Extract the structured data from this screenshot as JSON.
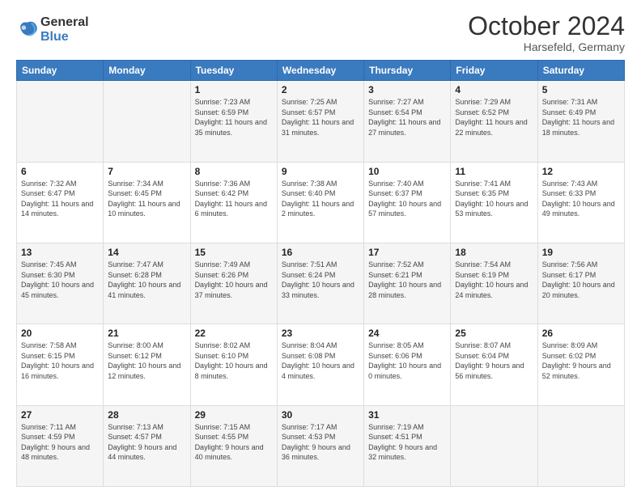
{
  "logo": {
    "general": "General",
    "blue": "Blue"
  },
  "header": {
    "month": "October 2024",
    "location": "Harsefeld, Germany"
  },
  "weekdays": [
    "Sunday",
    "Monday",
    "Tuesday",
    "Wednesday",
    "Thursday",
    "Friday",
    "Saturday"
  ],
  "weeks": [
    [
      {
        "day": "",
        "info": ""
      },
      {
        "day": "",
        "info": ""
      },
      {
        "day": "1",
        "info": "Sunrise: 7:23 AM\nSunset: 6:59 PM\nDaylight: 11 hours and 35 minutes."
      },
      {
        "day": "2",
        "info": "Sunrise: 7:25 AM\nSunset: 6:57 PM\nDaylight: 11 hours and 31 minutes."
      },
      {
        "day": "3",
        "info": "Sunrise: 7:27 AM\nSunset: 6:54 PM\nDaylight: 11 hours and 27 minutes."
      },
      {
        "day": "4",
        "info": "Sunrise: 7:29 AM\nSunset: 6:52 PM\nDaylight: 11 hours and 22 minutes."
      },
      {
        "day": "5",
        "info": "Sunrise: 7:31 AM\nSunset: 6:49 PM\nDaylight: 11 hours and 18 minutes."
      }
    ],
    [
      {
        "day": "6",
        "info": "Sunrise: 7:32 AM\nSunset: 6:47 PM\nDaylight: 11 hours and 14 minutes."
      },
      {
        "day": "7",
        "info": "Sunrise: 7:34 AM\nSunset: 6:45 PM\nDaylight: 11 hours and 10 minutes."
      },
      {
        "day": "8",
        "info": "Sunrise: 7:36 AM\nSunset: 6:42 PM\nDaylight: 11 hours and 6 minutes."
      },
      {
        "day": "9",
        "info": "Sunrise: 7:38 AM\nSunset: 6:40 PM\nDaylight: 11 hours and 2 minutes."
      },
      {
        "day": "10",
        "info": "Sunrise: 7:40 AM\nSunset: 6:37 PM\nDaylight: 10 hours and 57 minutes."
      },
      {
        "day": "11",
        "info": "Sunrise: 7:41 AM\nSunset: 6:35 PM\nDaylight: 10 hours and 53 minutes."
      },
      {
        "day": "12",
        "info": "Sunrise: 7:43 AM\nSunset: 6:33 PM\nDaylight: 10 hours and 49 minutes."
      }
    ],
    [
      {
        "day": "13",
        "info": "Sunrise: 7:45 AM\nSunset: 6:30 PM\nDaylight: 10 hours and 45 minutes."
      },
      {
        "day": "14",
        "info": "Sunrise: 7:47 AM\nSunset: 6:28 PM\nDaylight: 10 hours and 41 minutes."
      },
      {
        "day": "15",
        "info": "Sunrise: 7:49 AM\nSunset: 6:26 PM\nDaylight: 10 hours and 37 minutes."
      },
      {
        "day": "16",
        "info": "Sunrise: 7:51 AM\nSunset: 6:24 PM\nDaylight: 10 hours and 33 minutes."
      },
      {
        "day": "17",
        "info": "Sunrise: 7:52 AM\nSunset: 6:21 PM\nDaylight: 10 hours and 28 minutes."
      },
      {
        "day": "18",
        "info": "Sunrise: 7:54 AM\nSunset: 6:19 PM\nDaylight: 10 hours and 24 minutes."
      },
      {
        "day": "19",
        "info": "Sunrise: 7:56 AM\nSunset: 6:17 PM\nDaylight: 10 hours and 20 minutes."
      }
    ],
    [
      {
        "day": "20",
        "info": "Sunrise: 7:58 AM\nSunset: 6:15 PM\nDaylight: 10 hours and 16 minutes."
      },
      {
        "day": "21",
        "info": "Sunrise: 8:00 AM\nSunset: 6:12 PM\nDaylight: 10 hours and 12 minutes."
      },
      {
        "day": "22",
        "info": "Sunrise: 8:02 AM\nSunset: 6:10 PM\nDaylight: 10 hours and 8 minutes."
      },
      {
        "day": "23",
        "info": "Sunrise: 8:04 AM\nSunset: 6:08 PM\nDaylight: 10 hours and 4 minutes."
      },
      {
        "day": "24",
        "info": "Sunrise: 8:05 AM\nSunset: 6:06 PM\nDaylight: 10 hours and 0 minutes."
      },
      {
        "day": "25",
        "info": "Sunrise: 8:07 AM\nSunset: 6:04 PM\nDaylight: 9 hours and 56 minutes."
      },
      {
        "day": "26",
        "info": "Sunrise: 8:09 AM\nSunset: 6:02 PM\nDaylight: 9 hours and 52 minutes."
      }
    ],
    [
      {
        "day": "27",
        "info": "Sunrise: 7:11 AM\nSunset: 4:59 PM\nDaylight: 9 hours and 48 minutes."
      },
      {
        "day": "28",
        "info": "Sunrise: 7:13 AM\nSunset: 4:57 PM\nDaylight: 9 hours and 44 minutes."
      },
      {
        "day": "29",
        "info": "Sunrise: 7:15 AM\nSunset: 4:55 PM\nDaylight: 9 hours and 40 minutes."
      },
      {
        "day": "30",
        "info": "Sunrise: 7:17 AM\nSunset: 4:53 PM\nDaylight: 9 hours and 36 minutes."
      },
      {
        "day": "31",
        "info": "Sunrise: 7:19 AM\nSunset: 4:51 PM\nDaylight: 9 hours and 32 minutes."
      },
      {
        "day": "",
        "info": ""
      },
      {
        "day": "",
        "info": ""
      }
    ]
  ]
}
